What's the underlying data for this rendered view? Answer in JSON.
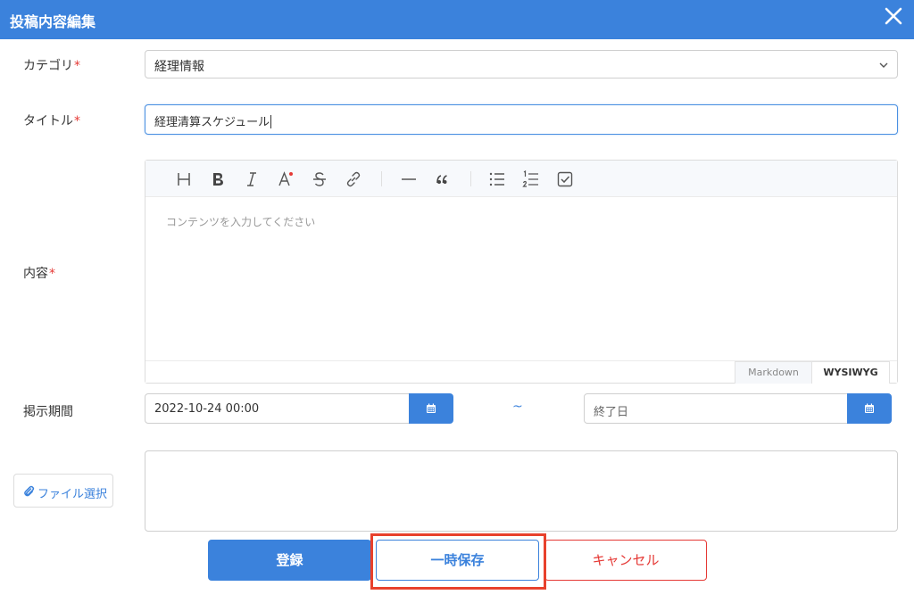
{
  "dialog": {
    "title": "投稿内容編集"
  },
  "form": {
    "category": {
      "label": "カテゴリ",
      "required_mark": "*",
      "value": "経理情報"
    },
    "title": {
      "label": "タイトル",
      "required_mark": "*",
      "value": "経理清算スケジュール"
    },
    "content": {
      "label": "内容",
      "required_mark": "*",
      "placeholder": "コンテンツを入力してください",
      "modes": [
        "Markdown",
        "WYSIWYG"
      ],
      "active_mode": "WYSIWYG",
      "toolbar": [
        "heading",
        "bold",
        "italic",
        "text-color",
        "strike",
        "link",
        "hr",
        "quote",
        "bullet-list",
        "ordered-list",
        "task-list"
      ]
    },
    "period": {
      "label": "掲示期間",
      "start": "2022-10-24 00:00",
      "separator": "~",
      "end_placeholder": "終了日"
    },
    "file": {
      "button_label": "ファイル選択"
    }
  },
  "actions": {
    "register": "登録",
    "temp_save": "一時保存",
    "cancel": "キャンセル"
  },
  "colors": {
    "accent": "#3b82dc",
    "danger": "#e53935",
    "highlight": "#e8412c"
  }
}
